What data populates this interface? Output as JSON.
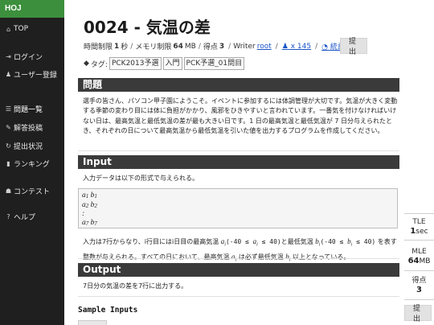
{
  "brand": "HOJ",
  "sidebar": {
    "items": [
      {
        "icon": "home-icon",
        "glyph": "⌂",
        "label": "TOP"
      },
      {
        "icon": "sign-in-icon",
        "glyph": "⇥",
        "label": "ログイン"
      },
      {
        "icon": "user-add-icon",
        "glyph": "👤",
        "label": "ユーザー登録"
      },
      {
        "icon": "list-icon",
        "glyph": "☰",
        "label": "問題一覧"
      },
      {
        "icon": "edit-icon",
        "glyph": "✎",
        "label": "解答投稿"
      },
      {
        "icon": "refresh-icon",
        "glyph": "↻",
        "label": "提出状況"
      },
      {
        "icon": "bar-chart-icon",
        "glyph": "▮",
        "label": "ランキング"
      },
      {
        "icon": "users-icon",
        "glyph": "☗",
        "label": "コンテスト"
      },
      {
        "icon": "question-icon",
        "glyph": "?",
        "label": "ヘルプ"
      }
    ]
  },
  "problem": {
    "title": "0024 - 気温の差",
    "time_limit_label": "時間制限",
    "time_limit_value": "1",
    "time_limit_unit": "秒",
    "memory_limit_label": "メモリ制限",
    "memory_limit_value": "64",
    "memory_limit_unit": "MB",
    "score_label": "得点",
    "score_value": "3",
    "writer_label": "Writer",
    "writer_name": "root",
    "solvers": "x 145",
    "stats_link": "統計",
    "submit_label": "提出",
    "tags_label": "タグ:",
    "tags": [
      "PCK2013予選",
      "入門",
      "PCK予選_01問目"
    ]
  },
  "sections": {
    "problem_heading": "問題",
    "problem_text": "選手の皆さん、パソコン甲子園にようこそ。イベントに参加するには体調管理が大切です。気温が大きく変動する季節の変わり目には体に負担がかかり、風邪をひきやすいと言われています。一番気を付けなければいけない日は、最高気温と最低気温の差が最も大きい日です。1 日の最高気温と最低気温が 7 日分与えられたとき、それぞれの日について最高気温から最低気温を引いた値を出力するプログラムを作成してください。",
    "input_heading": "Input",
    "input_intro": "入力データは以下の形式で与えられる。",
    "format_lines": [
      [
        "a",
        "1",
        "b",
        "1"
      ],
      [
        "a",
        "2",
        "b",
        "2"
      ],
      [
        ":"
      ],
      [
        "a",
        "7",
        "b",
        "7"
      ]
    ],
    "input_desc_1": "入力は7行からなり、i行目にはi日目の最高気温",
    "input_desc_ai": "a",
    "input_desc_ai_sub": "i",
    "input_desc_range_a": "(-40 ≤ ",
    "input_desc_range_a2": " ≤ 40)と最低気温",
    "input_desc_bi": "b",
    "input_desc_bi_sub": "i",
    "input_desc_range_b": "(-40 ≤ ",
    "input_desc_range_b2": " ≤ 40)",
    "input_desc_2": "を表す整数が与えられる。すべての日において、最高気温",
    "input_desc_3": "は必ず最低気温",
    "input_desc_4": "以上となっている。",
    "output_heading": "Output",
    "output_text": "7日分の気温の差を7行に出力する。",
    "sample_heading": "Sample Inputs"
  },
  "stats_panel": {
    "tle_label": "TLE",
    "tle_value": "1",
    "tle_unit": "sec",
    "mle_label": "MLE",
    "mle_value": "64",
    "mle_unit": "MB",
    "score_label": "得点",
    "score_value": "3",
    "submit_label": "提出"
  },
  "colors": {
    "brand": "#3c8f3c",
    "sidebar": "#1f1f1f",
    "section_header": "#3a3a3a",
    "link": "#1a55c6"
  }
}
